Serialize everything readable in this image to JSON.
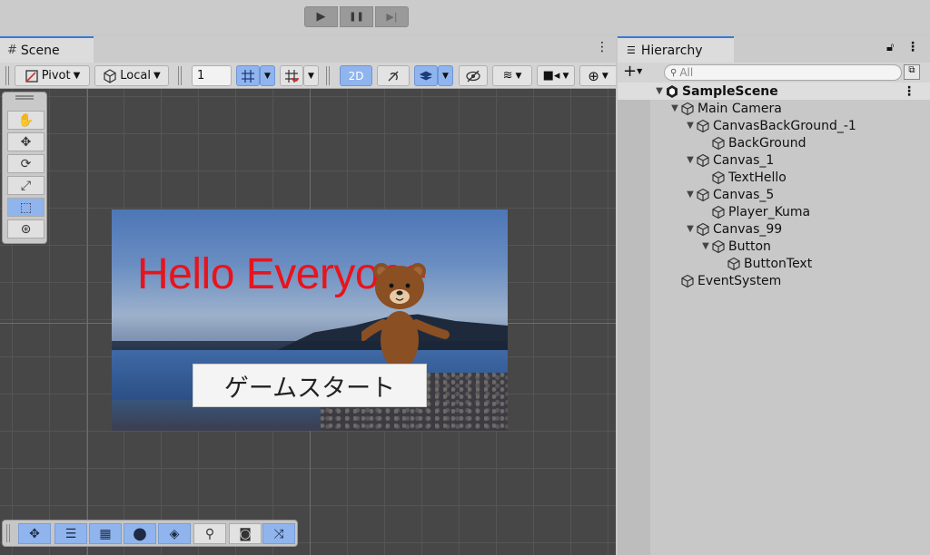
{
  "playbar": {
    "play_icon": "▶",
    "pause_icon": "❚❚",
    "step_icon": "▶|"
  },
  "scene_panel": {
    "tab_label": "Scene",
    "menu_icon": "⋮",
    "toolbar": {
      "pivot_label": "Pivot",
      "local_label": "Local",
      "grid_value": "1",
      "mode_2d_label": "2D"
    },
    "canvas": {
      "hello_text": "Hello Everyone",
      "button_text": "ゲームスタート"
    }
  },
  "hierarchy": {
    "tab_label": "Hierarchy",
    "add_label": "+",
    "search_placeholder": "All",
    "items": [
      {
        "label": "SampleScene",
        "depth": 0,
        "expanded": true,
        "scene": true
      },
      {
        "label": "Main Camera",
        "depth": 1,
        "expanded": true
      },
      {
        "label": "CanvasBackGround_-1",
        "depth": 2,
        "expanded": true
      },
      {
        "label": "BackGround",
        "depth": 3
      },
      {
        "label": "Canvas_1",
        "depth": 2,
        "expanded": true
      },
      {
        "label": "TextHello",
        "depth": 3
      },
      {
        "label": "Canvas_5",
        "depth": 2,
        "expanded": true
      },
      {
        "label": "Player_Kuma",
        "depth": 3
      },
      {
        "label": "Canvas_99",
        "depth": 2,
        "expanded": true
      },
      {
        "label": "Button",
        "depth": 3,
        "expanded": true
      },
      {
        "label": "ButtonText",
        "depth": 4
      },
      {
        "label": "EventSystem",
        "depth": 1
      }
    ]
  },
  "colors": {
    "accent": "#3a79d8",
    "active_button": "#8fb4ee",
    "viewport": "#474747",
    "hello_text": "#e8141c"
  }
}
